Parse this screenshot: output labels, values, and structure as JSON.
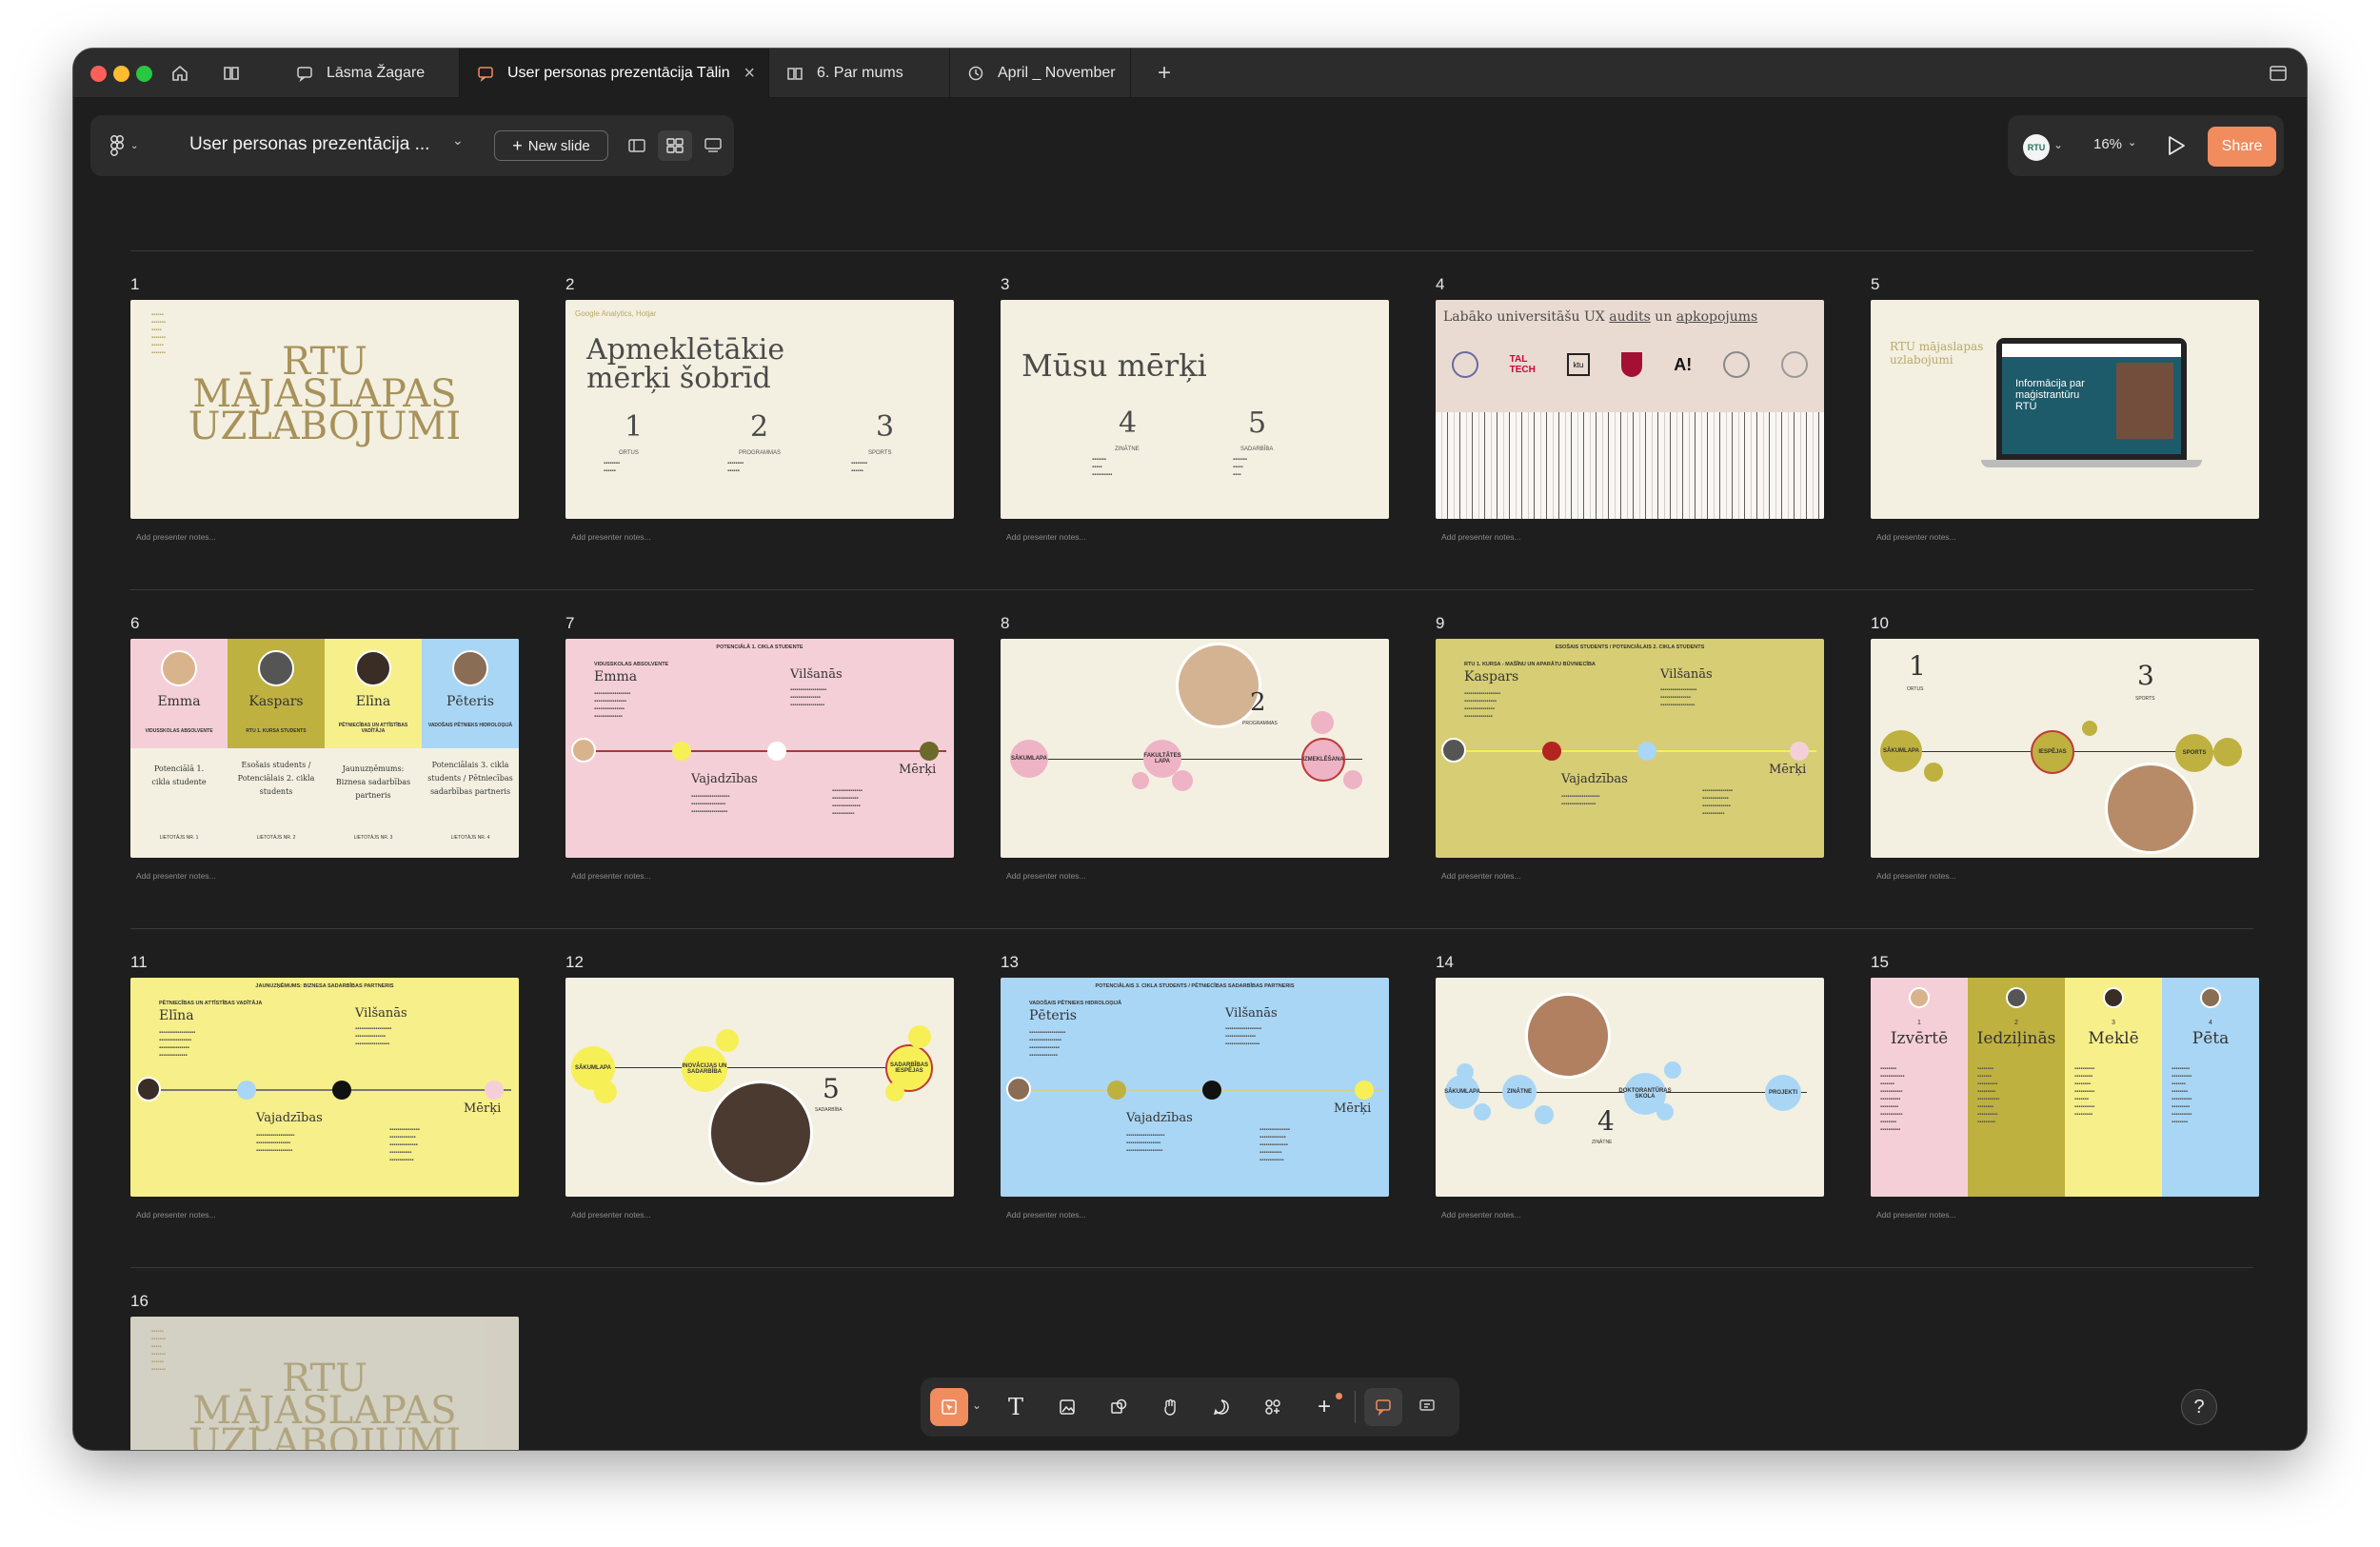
{
  "tabs": [
    {
      "label": "Lāsma Žagare",
      "icon": "comment-icon"
    },
    {
      "label": "User personas prezentācija Tālin",
      "icon": "comment-icon",
      "active": true
    },
    {
      "label": "6. Par mums",
      "icon": "book-icon"
    },
    {
      "label": "April _ November",
      "icon": "clock-icon"
    }
  ],
  "toolbar": {
    "doc_title": "User personas prezentācija ...",
    "new_slide": "New slide",
    "avatar": "RTU",
    "zoom": "16%",
    "share": "Share"
  },
  "notes_placeholder": "Add presenter notes...",
  "slides": [
    {
      "num": "1",
      "title_l1": "RTU",
      "title_l2": "MĀJASLAPAS",
      "title_l3": "UZLABOJUMI"
    },
    {
      "num": "2",
      "source": "Google Analytics, Hotjar",
      "title_l1": "Apmeklētākie",
      "title_l2": "mērķi šobrīd",
      "n1": "1",
      "n2": "2",
      "n3": "3",
      "l1": "ORTUS",
      "l2": "PROGRAMMAS",
      "l3": "SPORTS"
    },
    {
      "num": "3",
      "title": "Mūsu mērķi",
      "n1": "4",
      "n2": "5",
      "l1": "ZINĀTNE",
      "l2": "SADARBĪBA"
    },
    {
      "num": "4",
      "title_pre": "Labāko universitāšu UX",
      "title_u1": "audits",
      "title_mid": "un",
      "title_u2": "apkopojums"
    },
    {
      "num": "5",
      "title_l1": "RTU mājaslapas",
      "title_l2": "uzlabojumi",
      "screen_l1": "Informācija par",
      "screen_l2": "maģistrantūru",
      "screen_l3": "RTU"
    },
    {
      "num": "6",
      "personas": [
        {
          "name": "Emma",
          "role": "VIDUSSKOLAS ABSOLVENTE",
          "desc": "Potenciālā 1. cikla studente",
          "user": "LIETOTĀJS NR. 1"
        },
        {
          "name": "Kaspars",
          "role": "RTU 1. KURSA STUDENTS",
          "desc": "Esošais students / Potenciālais 2. cikla students",
          "user": "LIETOTĀJS NR. 2"
        },
        {
          "name": "Elīna",
          "role": "PĒTNIECĪBAS UN ATTĪSTĪBAS VADĪTĀJA",
          "desc": "Jaunuzņēmums: Biznesa sadarbības partneris",
          "user": "LIETOTĀJS NR. 3"
        },
        {
          "name": "Pēteris",
          "role": "VADOŠAIS PĒTNIEKS HIDROLOĢIJĀ",
          "desc": "Potenciālais 3. cikla students / Pētniecības sadarbības partneris",
          "user": "LIETOTĀJS NR. 4"
        }
      ]
    },
    {
      "num": "7",
      "header": "POTENCIĀLĀ 1. CIKLA STUDENTE",
      "role": "VIDUSSKOLAS ABSOLVENTE",
      "name": "Emma",
      "w1": "Vilšanās",
      "w2": "Vajadzības",
      "w3": "Mērķi"
    },
    {
      "num": "8",
      "start": "SĀKUMLAPA",
      "mid": "FAKULTĀTES LAPA",
      "end": "IZMEKLĒŠANA",
      "n": "2",
      "l": "PROGRAMMAS"
    },
    {
      "num": "9",
      "header": "ESOŠAIS STUDENTS / POTENCIĀLAIS 2. CIKLA STUDENTS",
      "role": "RTU 1. KURSA - MAŠĪNU UN APARĀTU BŪVNIECĪBA",
      "name": "Kaspars",
      "w1": "Vilšanās",
      "w2": "Vajadzības",
      "w3": "Mērķi"
    },
    {
      "num": "10",
      "n1": "1",
      "l1": "ORTUS",
      "n2": "3",
      "l2": "SPORTS",
      "c1": "SĀKUMLAPA",
      "c2": "IESPĒJAS",
      "c3": "SPORTS"
    },
    {
      "num": "11",
      "header": "JAUNUZŅĒMUMS: BIZNESA SADARBĪBAS PARTNERIS",
      "role": "PĒTNIECĪBAS UN ATTĪSTĪBAS VADĪTĀJA",
      "name": "Elīna",
      "w1": "Vilšanās",
      "w2": "Vajadzības",
      "w3": "Mērķi"
    },
    {
      "num": "12",
      "c1": "SĀKUMLAPA",
      "c2": "INOVĀCIJAS UN SADARBĪBA",
      "c3": "SADARBĪBAS IESPĒJAS",
      "n": "5",
      "l": "SADARBĪBA"
    },
    {
      "num": "13",
      "header": "POTENCIĀLAIS 3. CIKLA STUDENTS / PĒTNIECĪBAS SADARBĪBAS PARTNERIS",
      "role": "VADOŠAIS PĒTNIEKS HIDROLOĢIJĀ",
      "name": "Pēteris",
      "w1": "Vilšanās",
      "w2": "Vajadzības",
      "w3": "Mērķi"
    },
    {
      "num": "14",
      "c1": "SĀKUMLAPA",
      "c2": "ZINĀTNE",
      "c3": "DOKTORANTŪRAS SKOLA",
      "c4": "PROJEKTI",
      "n": "4",
      "l": "ZINĀTNE"
    },
    {
      "num": "15",
      "cols": [
        {
          "n": "1",
          "title": "Izvērtē"
        },
        {
          "n": "2",
          "title": "Iedziļinās"
        },
        {
          "n": "3",
          "title": "Meklē"
        },
        {
          "n": "4",
          "title": "Pēta"
        }
      ]
    },
    {
      "num": "16",
      "title_l1": "RTU",
      "title_l2": "MĀJASLAPAS",
      "title_l3": "UZLABOJUMI"
    }
  ],
  "colors": {
    "cream": "#f3f0e1",
    "pink": "#f5cfd8",
    "olive": "#bfb13f",
    "yellow": "#f7ef8a",
    "blue": "#a9d6f5",
    "accent": "#f08c5e"
  }
}
